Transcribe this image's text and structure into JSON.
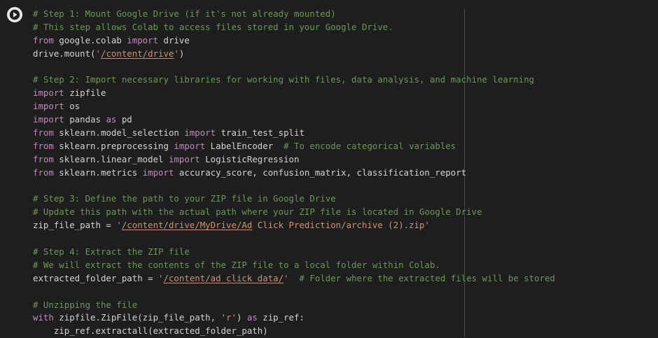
{
  "cell": {
    "run_button_icon": "play-icon",
    "accent_colors": {
      "background": "#1e1e1e",
      "comment": "#6a9955",
      "keyword": "#c586c0",
      "string": "#ce9178",
      "plain": "#d4d4d4"
    },
    "lines": [
      [
        {
          "t": "comment",
          "v": "# Step 1: Mount Google Drive (if it's not already mounted)"
        }
      ],
      [
        {
          "t": "comment",
          "v": "# This step allows Colab to access files stored in your Google Drive."
        }
      ],
      [
        {
          "t": "keyword",
          "v": "from"
        },
        {
          "t": "plain",
          "v": " google.colab "
        },
        {
          "t": "keyword",
          "v": "import"
        },
        {
          "t": "plain",
          "v": " drive"
        }
      ],
      [
        {
          "t": "plain",
          "v": "drive.mount("
        },
        {
          "t": "string",
          "v": "'"
        },
        {
          "t": "link",
          "v": "/content/drive"
        },
        {
          "t": "string",
          "v": "'"
        },
        {
          "t": "plain",
          "v": ")"
        }
      ],
      [],
      [
        {
          "t": "comment",
          "v": "# Step 2: Import necessary libraries for working with files, data analysis, and machine learning"
        }
      ],
      [
        {
          "t": "keyword",
          "v": "import"
        },
        {
          "t": "plain",
          "v": " zipfile"
        }
      ],
      [
        {
          "t": "keyword",
          "v": "import"
        },
        {
          "t": "plain",
          "v": " os"
        }
      ],
      [
        {
          "t": "keyword",
          "v": "import"
        },
        {
          "t": "plain",
          "v": " pandas "
        },
        {
          "t": "keyword",
          "v": "as"
        },
        {
          "t": "plain",
          "v": " pd"
        }
      ],
      [
        {
          "t": "keyword",
          "v": "from"
        },
        {
          "t": "plain",
          "v": " sklearn.model_selection "
        },
        {
          "t": "keyword",
          "v": "import"
        },
        {
          "t": "plain",
          "v": " train_test_split"
        }
      ],
      [
        {
          "t": "keyword",
          "v": "from"
        },
        {
          "t": "plain",
          "v": " sklearn.preprocessing "
        },
        {
          "t": "keyword",
          "v": "import"
        },
        {
          "t": "plain",
          "v": " LabelEncoder  "
        },
        {
          "t": "comment",
          "v": "# To encode categorical variables"
        }
      ],
      [
        {
          "t": "keyword",
          "v": "from"
        },
        {
          "t": "plain",
          "v": " sklearn.linear_model "
        },
        {
          "t": "keyword",
          "v": "import"
        },
        {
          "t": "plain",
          "v": " LogisticRegression"
        }
      ],
      [
        {
          "t": "keyword",
          "v": "from"
        },
        {
          "t": "plain",
          "v": " sklearn.metrics "
        },
        {
          "t": "keyword",
          "v": "import"
        },
        {
          "t": "plain",
          "v": " accuracy_score, confusion_matrix, classification_report"
        }
      ],
      [],
      [
        {
          "t": "comment",
          "v": "# Step 3: Define the path to your ZIP file in Google Drive"
        }
      ],
      [
        {
          "t": "comment",
          "v": "# Update this path with the actual path where your ZIP file is located in Google Drive"
        }
      ],
      [
        {
          "t": "plain",
          "v": "zip_file_path = "
        },
        {
          "t": "string",
          "v": "'"
        },
        {
          "t": "link",
          "v": "/content/drive/MyDrive/Ad"
        },
        {
          "t": "string",
          "v": " Click Prediction/archive (2).zip'"
        }
      ],
      [],
      [
        {
          "t": "comment",
          "v": "# Step 4: Extract the ZIP file"
        }
      ],
      [
        {
          "t": "comment",
          "v": "# We will extract the contents of the ZIP file to a local folder within Colab."
        }
      ],
      [
        {
          "t": "plain",
          "v": "extracted_folder_path = "
        },
        {
          "t": "string",
          "v": "'"
        },
        {
          "t": "link",
          "v": "/content/ad_click_data/"
        },
        {
          "t": "string",
          "v": "'"
        },
        {
          "t": "plain",
          "v": "  "
        },
        {
          "t": "comment",
          "v": "# Folder where the extracted files will be stored"
        }
      ],
      [],
      [
        {
          "t": "comment",
          "v": "# Unzipping the file"
        }
      ],
      [
        {
          "t": "keyword",
          "v": "with"
        },
        {
          "t": "plain",
          "v": " zipfile.ZipFile(zip_file_path, "
        },
        {
          "t": "string",
          "v": "'r'"
        },
        {
          "t": "plain",
          "v": ") "
        },
        {
          "t": "keyword",
          "v": "as"
        },
        {
          "t": "plain",
          "v": " zip_ref:"
        }
      ],
      [
        {
          "t": "plain",
          "v": "    zip_ref.extractall(extracted_folder_path)"
        }
      ]
    ]
  }
}
